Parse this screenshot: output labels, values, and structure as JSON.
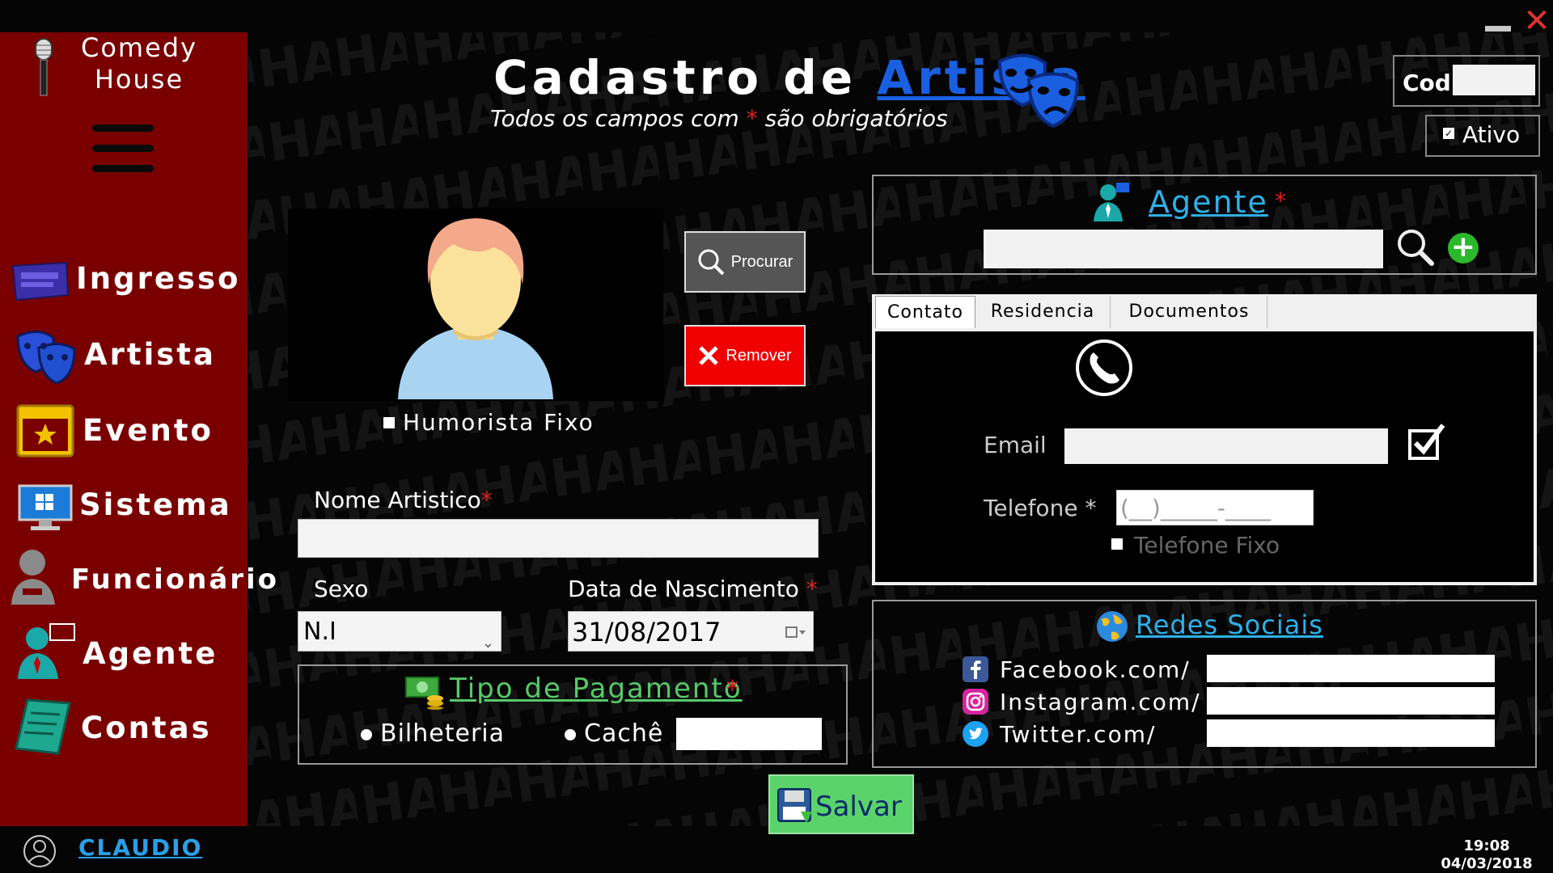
{
  "window": {
    "close_symbol": "✕"
  },
  "sidebar": {
    "brand": "Comedy House",
    "brand_line1": "Comedy",
    "brand_line2": "House",
    "items": [
      {
        "label": "Ingresso",
        "icon": "ticket-icon"
      },
      {
        "label": "Artista",
        "icon": "theater-masks-icon"
      },
      {
        "label": "Evento",
        "icon": "calendar-star-icon"
      },
      {
        "label": "Sistema",
        "icon": "monitor-windows-icon"
      },
      {
        "label": "Funcionário",
        "icon": "person-icon"
      },
      {
        "label": "Agente",
        "icon": "agent-icon"
      },
      {
        "label": "Contas",
        "icon": "ledger-icon"
      }
    ]
  },
  "footer": {
    "user": "CLAUDIO",
    "time": "19:08",
    "date": "04/03/2018"
  },
  "header": {
    "title_prefix": "Cadastro de",
    "title_highlight": "Artista",
    "subtitle_before": "Todos os campos com",
    "subtitle_star": "*",
    "subtitle_after": "são obrigatórios"
  },
  "cod": {
    "label": "Cod",
    "value": ""
  },
  "ativo": {
    "label": "Ativo",
    "checked": true
  },
  "photo": {
    "procurar_label": "Procurar",
    "remover_label": "Remover",
    "humorista_label": "Humorista Fixo"
  },
  "form": {
    "nome_label": "Nome Artistico",
    "nome_value": "",
    "sexo_label": "Sexo",
    "sexo_value": "N.I",
    "data_label": "Data de Nascimento",
    "data_value": "31/08/2017",
    "required_star": "*"
  },
  "pagamento": {
    "title": "Tipo de Pagamento",
    "star": "*",
    "option1": "Bilheteria",
    "option2": "Cachê",
    "cache_value": ""
  },
  "salvar": {
    "label": "Salvar"
  },
  "agente": {
    "title": "Agente",
    "star": "*",
    "value": ""
  },
  "tabs": [
    {
      "label": "Contato",
      "active": true
    },
    {
      "label": "Residencia",
      "active": false
    },
    {
      "label": "Documentos",
      "active": false
    }
  ],
  "contato": {
    "email_label": "Email",
    "email_value": "",
    "telefone_label": "Telefone",
    "telefone_star": "*",
    "telefone_mask": "(__)_____-____",
    "telefone_fixo_label": "Telefone Fixo"
  },
  "redes": {
    "title": "Redes Sociais",
    "items": [
      {
        "label": "Facebook.com/",
        "icon": "facebook-icon",
        "value": ""
      },
      {
        "label": "Instagram.com/",
        "icon": "instagram-icon",
        "value": ""
      },
      {
        "label": "Twitter.com/",
        "icon": "twitter-icon",
        "value": ""
      }
    ]
  },
  "colors": {
    "sidebar": "#7a0000",
    "accent_blue": "#1a5fe0",
    "link_blue": "#2eb0e8",
    "green": "#56c96a",
    "required_red": "#e02020"
  }
}
